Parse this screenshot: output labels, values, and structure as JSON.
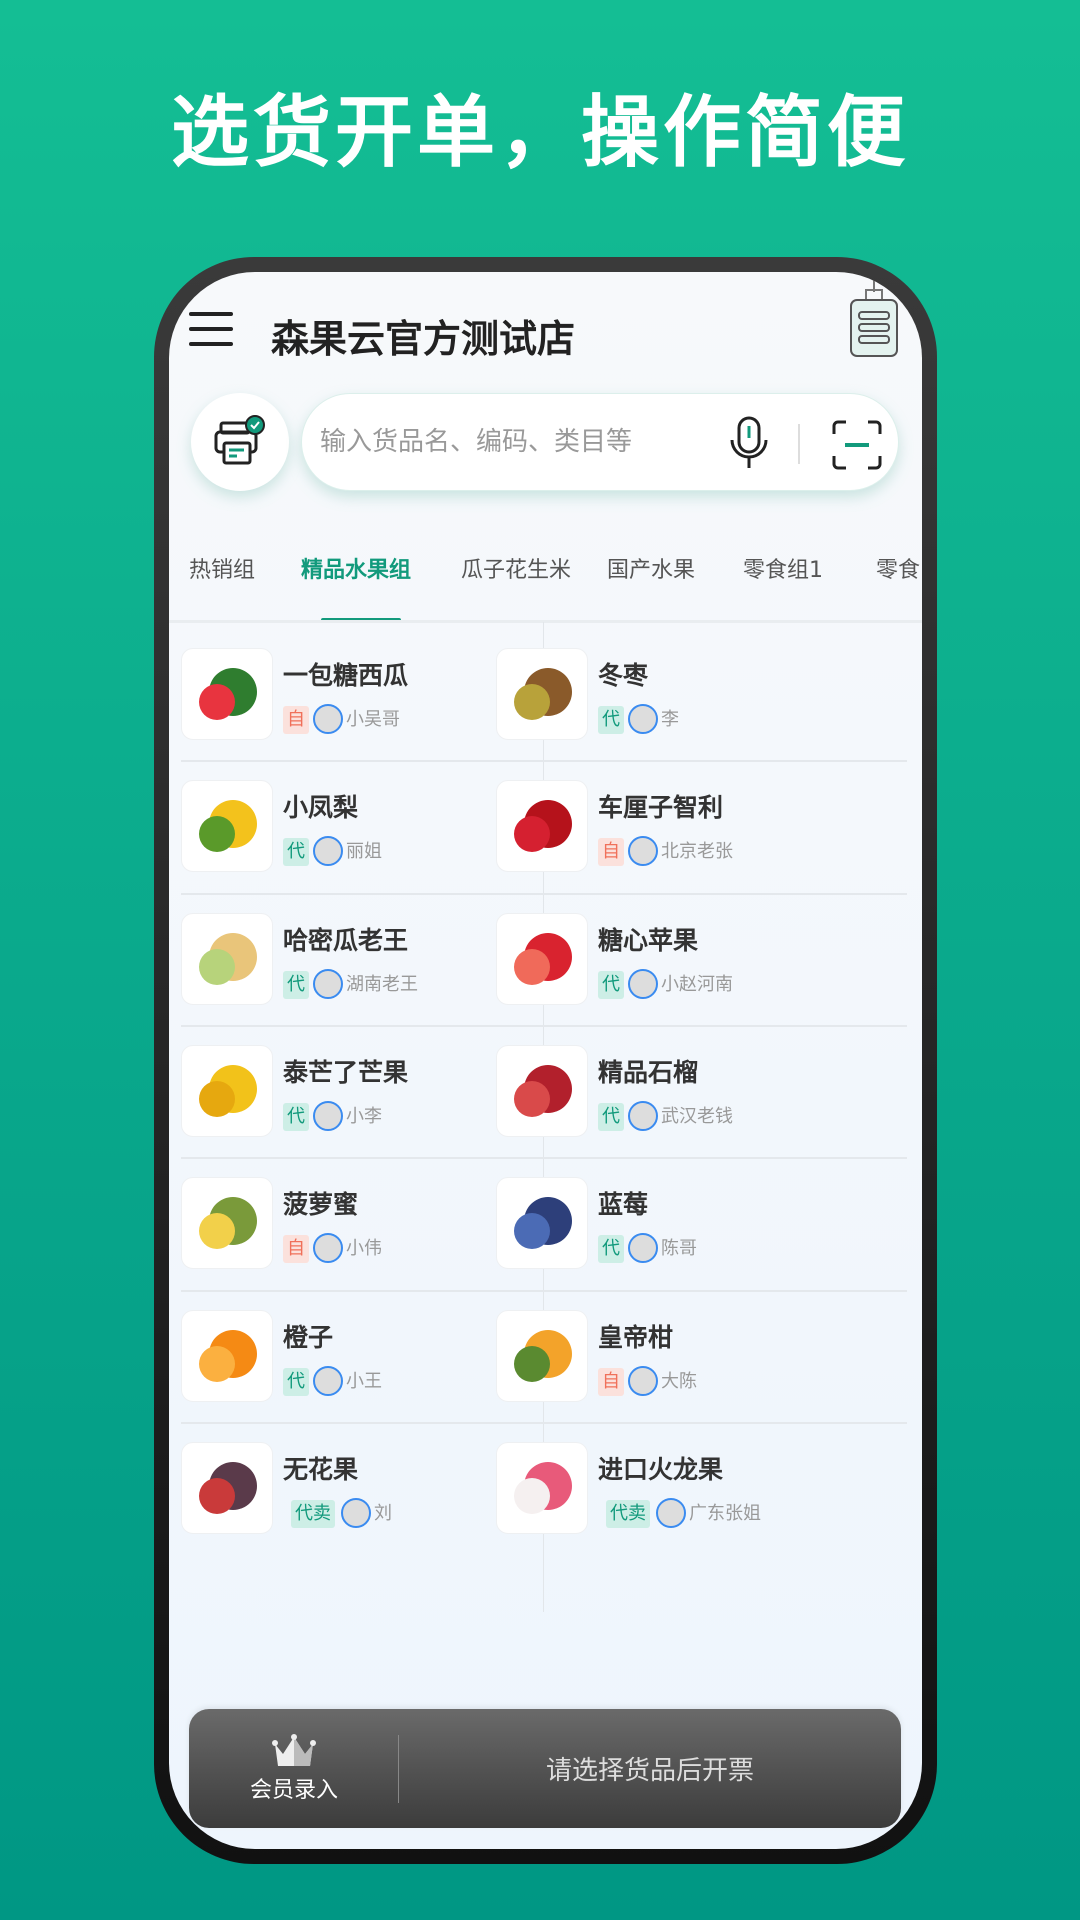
{
  "headline": "选货开单，操作简便",
  "header": {
    "title": "森果云官方测试店"
  },
  "search": {
    "placeholder": "输入货品名、编码、类目等"
  },
  "tabs": [
    {
      "label": "热销组",
      "active": false
    },
    {
      "label": "精品水果组",
      "active": true
    },
    {
      "label": "瓜子花生米",
      "active": false
    },
    {
      "label": "国产水果",
      "active": false
    },
    {
      "label": "零食组1",
      "active": false
    },
    {
      "label": "零食",
      "active": false
    }
  ],
  "products": [
    {
      "name": "一包糖西瓜",
      "tag": "自",
      "seller": "小吴哥",
      "icon": "watermelon"
    },
    {
      "name": "冬枣",
      "tag": "代",
      "seller": "李",
      "icon": "jujube"
    },
    {
      "name": "小凤梨",
      "tag": "代",
      "seller": "丽姐",
      "icon": "pineapple"
    },
    {
      "name": "车厘子智利",
      "tag": "自",
      "seller": "北京老张",
      "icon": "cherry"
    },
    {
      "name": "哈密瓜老王",
      "tag": "代",
      "seller": "湖南老王",
      "icon": "cantaloupe"
    },
    {
      "name": "糖心苹果",
      "tag": "代",
      "seller": "小赵河南",
      "icon": "apple"
    },
    {
      "name": "泰芒了芒果",
      "tag": "代",
      "seller": "小李",
      "icon": "mango"
    },
    {
      "name": "精品石榴",
      "tag": "代",
      "seller": "武汉老钱",
      "icon": "pomegranate"
    },
    {
      "name": "菠萝蜜",
      "tag": "自",
      "seller": "小伟",
      "icon": "jackfruit"
    },
    {
      "name": "蓝莓",
      "tag": "代",
      "seller": "陈哥",
      "icon": "blueberry"
    },
    {
      "name": "橙子",
      "tag": "代",
      "seller": "小王",
      "icon": "orange"
    },
    {
      "name": "皇帝柑",
      "tag": "自",
      "seller": "大陈",
      "icon": "mandarin"
    },
    {
      "name": "无花果",
      "tag": "代卖",
      "seller": "刘",
      "icon": "fig"
    },
    {
      "name": "进口火龙果",
      "tag": "代卖",
      "seller": "广东张姐",
      "icon": "dragonfruit"
    }
  ],
  "bottom_bar": {
    "member_label": "会员录入",
    "invoice_label": "请选择货品后开票"
  },
  "colors": {
    "accent": "#129a7c",
    "tag_self": "#f0705a",
    "tag_agent": "#129a7c",
    "background": "#14be94"
  }
}
